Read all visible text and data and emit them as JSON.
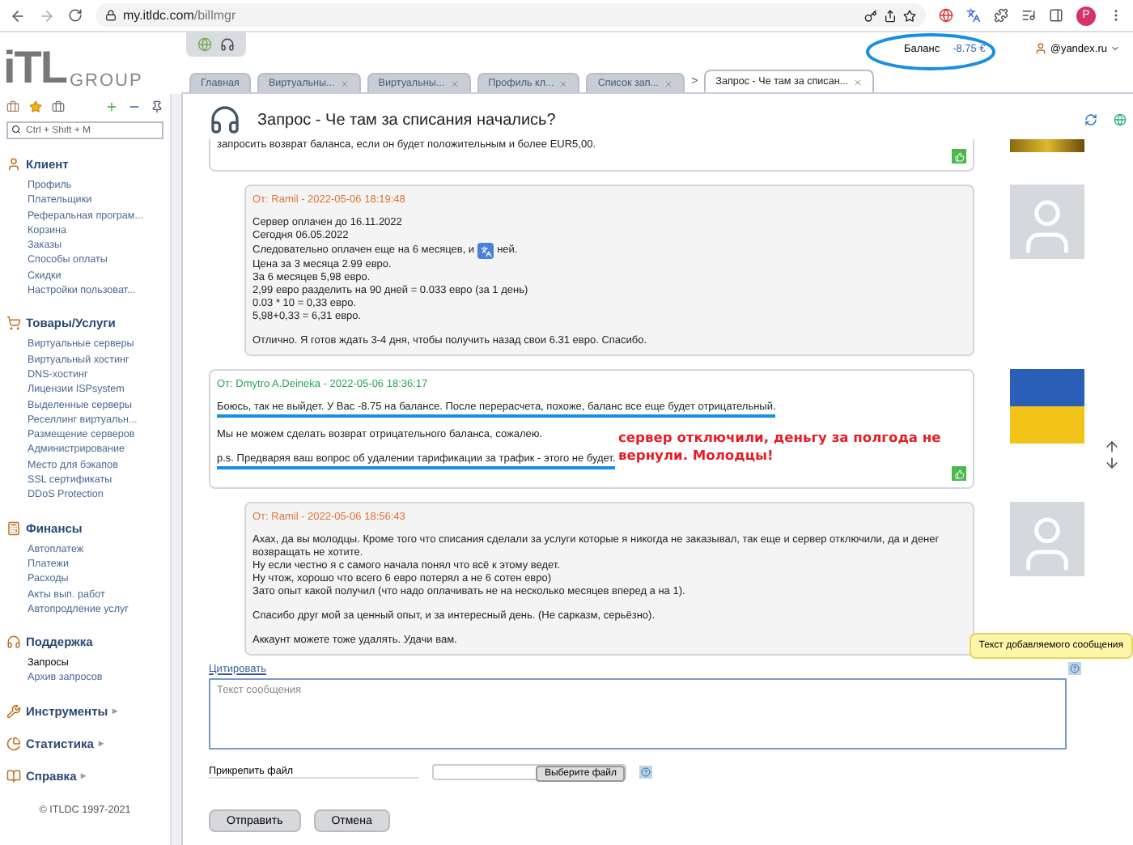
{
  "browser": {
    "host": "my.itldc.com",
    "path": "/billmgr",
    "profile_letter": "P"
  },
  "logo": {
    "mark": "iTL",
    "word": "GROUP"
  },
  "header": {
    "balance_label": "Баланс",
    "balance_value": "-8.75 €",
    "user": "@yandex.ru"
  },
  "tabs": [
    {
      "label": "Главная",
      "closable": false,
      "selected": false
    },
    {
      "label": "Виртуальны...",
      "closable": true,
      "selected": false
    },
    {
      "label": "Виртуальны...",
      "closable": true,
      "selected": false
    },
    {
      "label": "Профиль кл...",
      "closable": true,
      "selected": false
    },
    {
      "label": "Список зап...",
      "closable": true,
      "selected": false
    },
    {
      "label": "Запрос - Че там за списан...",
      "closable": true,
      "selected": true
    }
  ],
  "tab_scroll": ">",
  "sidebar": {
    "search_placeholder": "Ctrl + Shift + M",
    "sections": [
      {
        "title": "Клиент",
        "items": [
          {
            "label": "Профиль",
            "selected": false
          },
          {
            "label": "Плательщики",
            "selected": false
          },
          {
            "label": "Реферальная програм...",
            "selected": false
          },
          {
            "label": "Корзина",
            "selected": false
          },
          {
            "label": "Заказы",
            "selected": false
          },
          {
            "label": "Способы оплаты",
            "selected": false
          },
          {
            "label": "Скидки",
            "selected": false
          },
          {
            "label": "Настройки пользоват...",
            "selected": false
          }
        ]
      },
      {
        "title": "Товары/Услуги",
        "items": [
          {
            "label": "Виртуальные серверы",
            "selected": false
          },
          {
            "label": "Виртуальный хостинг",
            "selected": false
          },
          {
            "label": "DNS-хостинг",
            "selected": false
          },
          {
            "label": "Лицензии ISPsystem",
            "selected": false
          },
          {
            "label": "Выделенные серверы",
            "selected": false
          },
          {
            "label": "Реселлинг виртуальн...",
            "selected": false
          },
          {
            "label": "Размещение серверов",
            "selected": false
          },
          {
            "label": "Администрирование",
            "selected": false
          },
          {
            "label": "Место для бэкапов",
            "selected": false
          },
          {
            "label": "SSL сертификаты",
            "selected": false
          },
          {
            "label": "DDoS Protection",
            "selected": false
          }
        ]
      },
      {
        "title": "Финансы",
        "items": [
          {
            "label": "Автоплатеж",
            "selected": false
          },
          {
            "label": "Платежи",
            "selected": false
          },
          {
            "label": "Расходы",
            "selected": false
          },
          {
            "label": "Акты вып. работ",
            "selected": false
          },
          {
            "label": "Автопродление услуг",
            "selected": false
          }
        ]
      },
      {
        "title": "Поддержка",
        "items": [
          {
            "label": "Запросы",
            "selected": true
          },
          {
            "label": "Архив запросов",
            "selected": false
          }
        ]
      },
      {
        "title": "Инструменты",
        "expand_arrow": "▸"
      },
      {
        "title": "Статистика",
        "expand_arrow": "▸"
      },
      {
        "title": "Справка",
        "expand_arrow": "▸"
      }
    ],
    "copyright": "© ITLDC 1997-2021"
  },
  "page_title": "Запрос - Че там за списания начались?",
  "messages": [
    {
      "kind": "staff",
      "cut": true,
      "blocks": [
        [
          {
            "text": "запросить возврат баланса, если он будет положительным и более EUR5,00.",
            "underlined": false
          }
        ]
      ]
    },
    {
      "kind": "client",
      "author": "От: Ramil - 2022-05-06 18:19:48",
      "blocks": [
        [
          {
            "text": "Сервер оплачен до 16.11.2022",
            "underlined": false
          },
          {
            "text": "Сегодня 06.05.2022",
            "underlined": false
          },
          {
            "text": "Следовательно оплачен еще на 6 месяцев, и",
            "text_after": "ней.",
            "underlined": false
          },
          {
            "text": "Цена за 3 месяца 2.99 евро.",
            "underlined": false
          },
          {
            "text": "За 6 месяцев 5,98 евро.",
            "underlined": false
          },
          {
            "text": "2,99 евро разделить на 90 дней = 0.033 евро (за 1 день)",
            "underlined": false
          },
          {
            "text": "0.03 * 10 = 0,33 евро.",
            "underlined": false
          },
          {
            "text": "5,98+0,33 = 6,31 евро.",
            "underlined": false
          }
        ],
        [
          {
            "text": "Отлично. Я готов ждать 3-4 дня, чтобы получить назад свои 6.31 евро. Спасибо.",
            "underlined": false
          }
        ]
      ]
    },
    {
      "kind": "staff",
      "author": "От: Dmytro A.Deineka - 2022-05-06 18:36:17",
      "blocks": [
        [
          {
            "text": "Боюсь, так не выйдет. У Вас -8.75 на балансе. После перерасчета, похоже, баланс все еще будет отрицательный.",
            "underlined": true
          }
        ],
        [
          {
            "text": "Мы не можем сделать возврат отрицательного баланса, сожалею.",
            "underlined": false
          }
        ],
        [
          {
            "text": "p.s. Предваряя ваш вопрос об удалении тарификации за трафик - этого не будет.",
            "underlined": true
          }
        ]
      ],
      "annotation": "сервер отключили, деньгу за полгода не вернули. Молодцы!"
    },
    {
      "kind": "client",
      "author": "От: Ramil - 2022-05-06 18:56:43",
      "blocks": [
        [
          {
            "text": "Ахах, да вы молодцы. Кроме того что списания сделали за услуги которые я никогда не заказывал, так еще и сервер отключили, да и денег возвращать не хотите.",
            "underlined": false
          },
          {
            "text": "Ну если честно я с самого начала понял что всё к этому ведет.",
            "underlined": false
          },
          {
            "text": "Ну чтож, хорошо что всего 6 евро потерял а не 6 сотен евро)",
            "underlined": false
          },
          {
            "text": "Зато опыт какой получил (что надо оплачивать не на несколько месяцев вперед а на 1).",
            "underlined": false
          }
        ],
        [
          {
            "text": "Спасибо друг мой за ценный опыт, и за интересный день. (Не сарказм, серьёзно).",
            "underlined": false
          }
        ],
        [
          {
            "text": "Аккаунт можете тоже удалять. Удачи вам.",
            "underlined": false
          }
        ]
      ]
    }
  ],
  "reply": {
    "tooltip": "Текст добавляемого сообщения",
    "cite_link": "Цитировать",
    "placeholder": "Текст сообщения",
    "file_label": "Прикрепить файл",
    "file_button": "Выберите файл"
  },
  "buttons": [
    "Отправить",
    "Отмена"
  ]
}
